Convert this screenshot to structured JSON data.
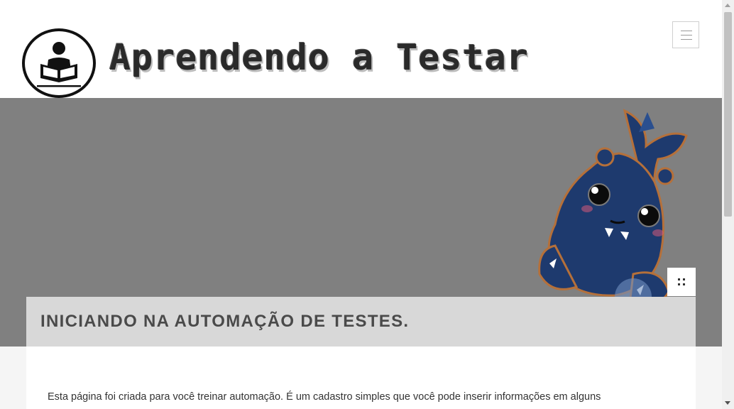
{
  "header": {
    "site_title": "Aprendendo a Testar",
    "logo_icon": "reading-person-icon",
    "menu_icon": "hamburger-menu-icon"
  },
  "hero": {
    "image": "blue-monster-mascot",
    "expand_icon": "expand-icon"
  },
  "article": {
    "title": "INICIANDO NA AUTOMAÇÃO DE TESTES.",
    "intro": "Esta página foi criada para você treinar automação. É um cadastro simples que você pode inserir informações em alguns"
  },
  "colors": {
    "hero_background": "#808080",
    "title_box": "#d8d8d8",
    "page_background": "#f5f5f5",
    "mascot_body": "#1e3a6e",
    "mascot_outline": "#b5703a"
  }
}
